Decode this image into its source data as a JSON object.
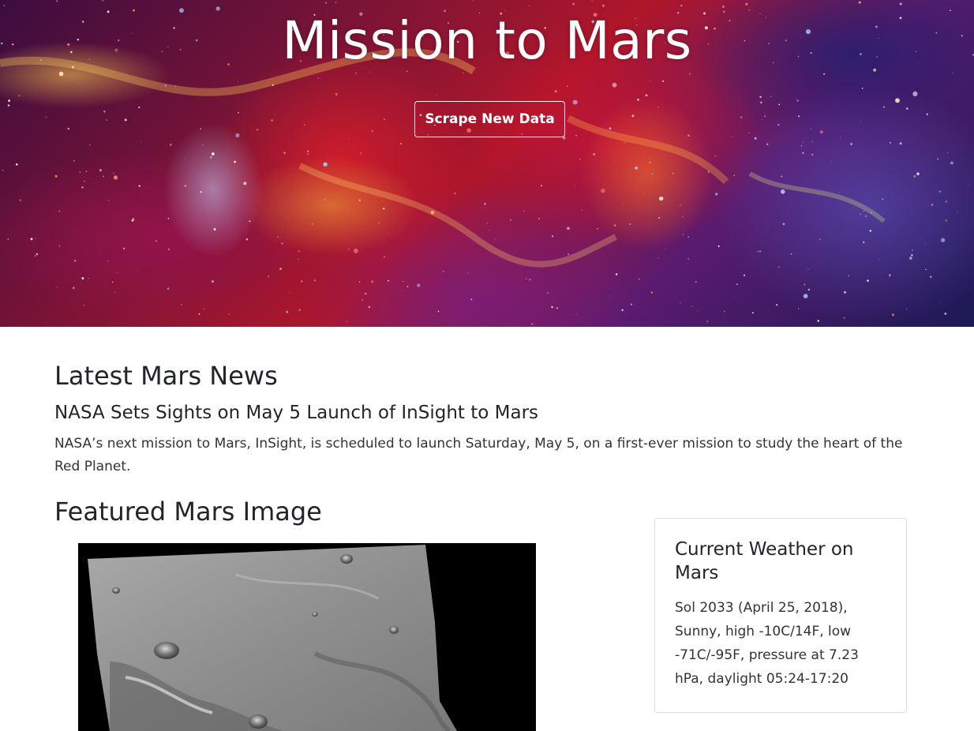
{
  "hero": {
    "title": "Mission to Mars",
    "scrape_button_label": "Scrape New Data",
    "background_description": "galaxy-nebula-background"
  },
  "news": {
    "heading": "Latest Mars News",
    "title": "NASA Sets Sights on May 5 Launch of InSight to Mars",
    "paragraph": "NASA’s next mission to Mars, InSight, is scheduled to launch Saturday, May 5, on a first-ever mission to study the heart of the Red Planet."
  },
  "featured": {
    "heading": "Featured Mars Image"
  },
  "weather": {
    "title": "Current Weather on Mars",
    "text": "Sol 2033 (April 25, 2018), Sunny, high -10C/14F, low -71C/-95F, pressure at 7.23 hPa, daylight 05:24-17:20"
  },
  "colors": {
    "text": "#212529",
    "button_border": "#ffffff",
    "card_border": "#dfdfdf"
  }
}
